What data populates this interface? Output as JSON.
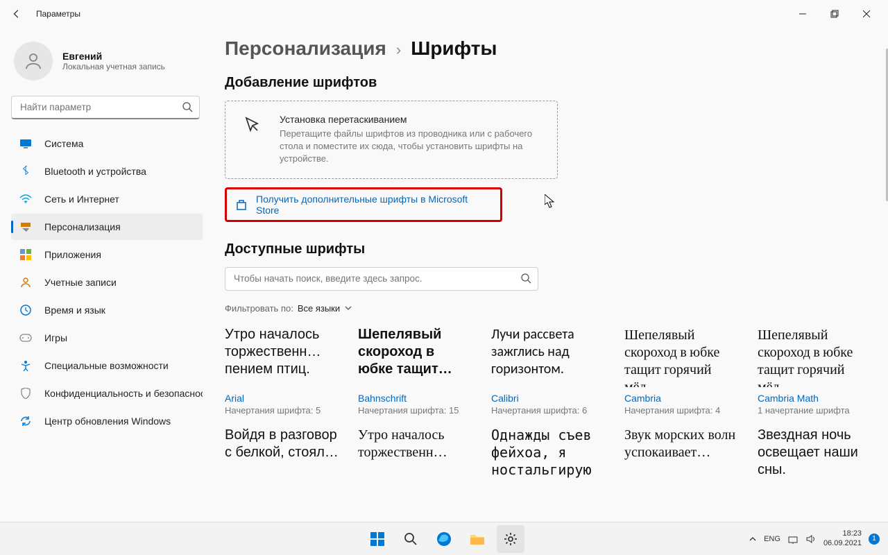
{
  "titlebar": {
    "label": "Параметры"
  },
  "user": {
    "name": "Евгений",
    "subtitle": "Локальная учетная запись"
  },
  "search": {
    "placeholder": "Найти параметр"
  },
  "nav": {
    "items": [
      {
        "label": "Система"
      },
      {
        "label": "Bluetooth и устройства"
      },
      {
        "label": "Сеть и Интернет"
      },
      {
        "label": "Персонализация"
      },
      {
        "label": "Приложения"
      },
      {
        "label": "Учетные записи"
      },
      {
        "label": "Время и язык"
      },
      {
        "label": "Игры"
      },
      {
        "label": "Специальные возможности"
      },
      {
        "label": "Конфиденциальность и безопасность"
      },
      {
        "label": "Центр обновления Windows"
      }
    ]
  },
  "breadcrumb": {
    "parent": "Персонализация",
    "sep": "›",
    "current": "Шрифты"
  },
  "sections": {
    "add_title": "Добавление шрифтов",
    "drop_title": "Установка перетаскиванием",
    "drop_sub": "Перетащите файлы шрифтов из проводника или с рабочего стола и поместите их сюда, чтобы установить шрифты на устройстве.",
    "store_link": "Получить дополнительные шрифты в Microsoft Store",
    "available_title": "Доступные шрифты",
    "font_search_placeholder": "Чтобы начать поиск, введите здесь запрос.",
    "filter_label": "Фильтровать по:",
    "filter_value": "Все языки"
  },
  "fonts": [
    {
      "sample": "Утро началось торжественн… пением птиц.",
      "name": "Arial",
      "faces": "Начертания шрифта: 5"
    },
    {
      "sample": "Шепелявый скороход в юбке тащит…",
      "name": "Bahnschrift",
      "faces": "Начертания шрифта: 15"
    },
    {
      "sample": "Лучи рассвета зажглись над горизонтом.",
      "name": "Calibri",
      "faces": "Начертания шрифта: 6"
    },
    {
      "sample": "Шепелявый скороход в юбке тащит горячий мёд.",
      "name": "Cambria",
      "faces": "Начертания шрифта: 4"
    },
    {
      "sample": "Шепелявый скороход в юбке тащит горячий мёд.",
      "name": "Cambria Math",
      "faces": "1 начертание шрифта"
    },
    {
      "sample": "Войдя в разговор с белкой, стоял…",
      "name": "",
      "faces": ""
    },
    {
      "sample": "Утро началось торжественн…",
      "name": "",
      "faces": ""
    },
    {
      "sample": "Однажды съев фейхоа, я ностальгирую",
      "name": "",
      "faces": ""
    },
    {
      "sample": "Звук морских волн успокаивает…",
      "name": "",
      "faces": ""
    },
    {
      "sample": "Звездная ночь освещает наши сны.",
      "name": "",
      "faces": ""
    }
  ],
  "taskbar": {
    "lang": "ENG",
    "time": "18:23",
    "date": "06.09.2021",
    "notif_count": "1"
  }
}
